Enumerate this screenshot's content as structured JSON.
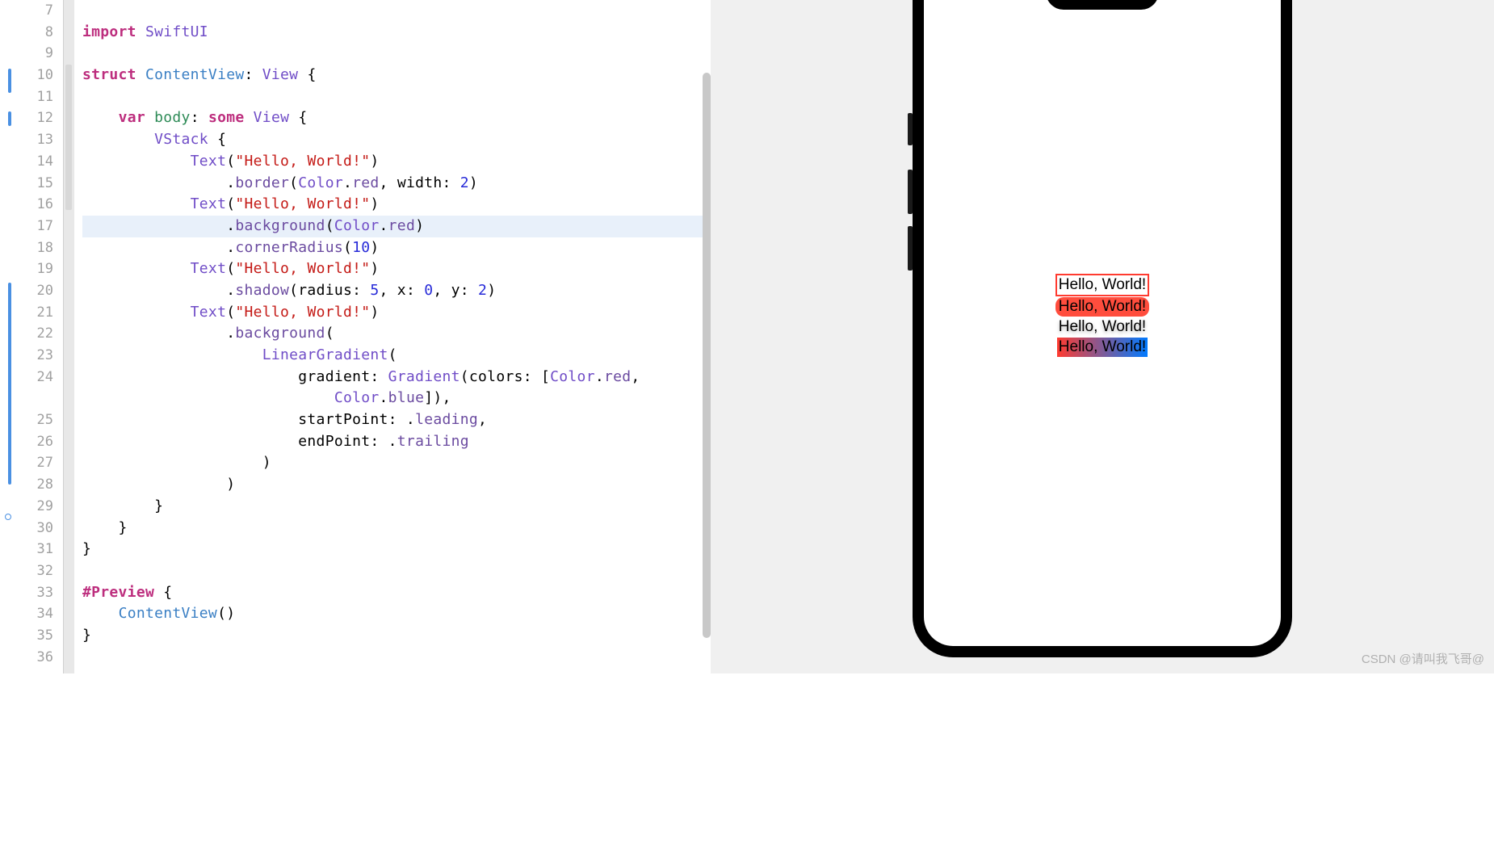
{
  "editor": {
    "lines": [
      {
        "num": 7,
        "tokens": []
      },
      {
        "num": 8,
        "tokens": [
          {
            "cls": "kw-pink",
            "t": "import"
          },
          {
            "cls": "plain",
            "t": " "
          },
          {
            "cls": "kw-builtin",
            "t": "SwiftUI"
          }
        ]
      },
      {
        "num": 9,
        "tokens": []
      },
      {
        "num": 10,
        "tokens": [
          {
            "cls": "kw-pink",
            "t": "struct"
          },
          {
            "cls": "plain",
            "t": " "
          },
          {
            "cls": "kw-type",
            "t": "ContentView"
          },
          {
            "cls": "plain",
            "t": ": "
          },
          {
            "cls": "kw-builtin",
            "t": "View"
          },
          {
            "cls": "plain",
            "t": " {"
          }
        ]
      },
      {
        "num": 11,
        "tokens": []
      },
      {
        "num": 12,
        "tokens": [
          {
            "cls": "plain",
            "t": "    "
          },
          {
            "cls": "kw-pink",
            "t": "var"
          },
          {
            "cls": "plain",
            "t": " "
          },
          {
            "cls": "kw-body",
            "t": "body"
          },
          {
            "cls": "plain",
            "t": ": "
          },
          {
            "cls": "kw-pink",
            "t": "some"
          },
          {
            "cls": "plain",
            "t": " "
          },
          {
            "cls": "kw-builtin",
            "t": "View"
          },
          {
            "cls": "plain",
            "t": " {"
          }
        ]
      },
      {
        "num": 13,
        "tokens": [
          {
            "cls": "plain",
            "t": "        "
          },
          {
            "cls": "kw-builtin",
            "t": "VStack"
          },
          {
            "cls": "plain",
            "t": " {"
          }
        ]
      },
      {
        "num": 14,
        "tokens": [
          {
            "cls": "plain",
            "t": "            "
          },
          {
            "cls": "kw-builtin",
            "t": "Text"
          },
          {
            "cls": "plain",
            "t": "("
          },
          {
            "cls": "kw-string",
            "t": "\"Hello, World!\""
          },
          {
            "cls": "plain",
            "t": ")"
          }
        ]
      },
      {
        "num": 15,
        "tokens": [
          {
            "cls": "plain",
            "t": "                ."
          },
          {
            "cls": "kw-method",
            "t": "border"
          },
          {
            "cls": "plain",
            "t": "("
          },
          {
            "cls": "kw-builtin",
            "t": "Color"
          },
          {
            "cls": "plain",
            "t": "."
          },
          {
            "cls": "kw-prop",
            "t": "red"
          },
          {
            "cls": "plain",
            "t": ", width: "
          },
          {
            "cls": "kw-num",
            "t": "2"
          },
          {
            "cls": "plain",
            "t": ")"
          }
        ]
      },
      {
        "num": 16,
        "tokens": [
          {
            "cls": "plain",
            "t": "            "
          },
          {
            "cls": "kw-builtin",
            "t": "Text"
          },
          {
            "cls": "plain",
            "t": "("
          },
          {
            "cls": "kw-string",
            "t": "\"Hello, World!\""
          },
          {
            "cls": "plain",
            "t": ")"
          }
        ]
      },
      {
        "num": 17,
        "highlighted": true,
        "tokens": [
          {
            "cls": "plain",
            "t": "                ."
          },
          {
            "cls": "kw-method",
            "t": "background"
          },
          {
            "cls": "plain",
            "t": "("
          },
          {
            "cls": "kw-builtin",
            "t": "Color"
          },
          {
            "cls": "plain",
            "t": "."
          },
          {
            "cls": "kw-prop",
            "t": "red"
          },
          {
            "cls": "plain",
            "t": ")"
          }
        ]
      },
      {
        "num": 18,
        "tokens": [
          {
            "cls": "plain",
            "t": "                ."
          },
          {
            "cls": "kw-method",
            "t": "cornerRadius"
          },
          {
            "cls": "plain",
            "t": "("
          },
          {
            "cls": "kw-num",
            "t": "10"
          },
          {
            "cls": "plain",
            "t": ")"
          }
        ]
      },
      {
        "num": 19,
        "tokens": [
          {
            "cls": "plain",
            "t": "            "
          },
          {
            "cls": "kw-builtin",
            "t": "Text"
          },
          {
            "cls": "plain",
            "t": "("
          },
          {
            "cls": "kw-string",
            "t": "\"Hello, World!\""
          },
          {
            "cls": "plain",
            "t": ")"
          }
        ]
      },
      {
        "num": 20,
        "tokens": [
          {
            "cls": "plain",
            "t": "                ."
          },
          {
            "cls": "kw-method",
            "t": "shadow"
          },
          {
            "cls": "plain",
            "t": "(radius: "
          },
          {
            "cls": "kw-num",
            "t": "5"
          },
          {
            "cls": "plain",
            "t": ", x: "
          },
          {
            "cls": "kw-num",
            "t": "0"
          },
          {
            "cls": "plain",
            "t": ", y: "
          },
          {
            "cls": "kw-num",
            "t": "2"
          },
          {
            "cls": "plain",
            "t": ")"
          }
        ]
      },
      {
        "num": 21,
        "tokens": [
          {
            "cls": "plain",
            "t": "            "
          },
          {
            "cls": "kw-builtin",
            "t": "Text"
          },
          {
            "cls": "plain",
            "t": "("
          },
          {
            "cls": "kw-string",
            "t": "\"Hello, World!\""
          },
          {
            "cls": "plain",
            "t": ")"
          }
        ]
      },
      {
        "num": 22,
        "tokens": [
          {
            "cls": "plain",
            "t": "                ."
          },
          {
            "cls": "kw-method",
            "t": "background"
          },
          {
            "cls": "plain",
            "t": "("
          }
        ]
      },
      {
        "num": 23,
        "tokens": [
          {
            "cls": "plain",
            "t": "                    "
          },
          {
            "cls": "kw-builtin",
            "t": "LinearGradient"
          },
          {
            "cls": "plain",
            "t": "("
          }
        ]
      },
      {
        "num": 24,
        "tokens": [
          {
            "cls": "plain",
            "t": "                        gradient: "
          },
          {
            "cls": "kw-builtin",
            "t": "Gradient"
          },
          {
            "cls": "plain",
            "t": "(colors: ["
          },
          {
            "cls": "kw-builtin",
            "t": "Color"
          },
          {
            "cls": "plain",
            "t": "."
          },
          {
            "cls": "kw-prop",
            "t": "red"
          },
          {
            "cls": "plain",
            "t": ","
          }
        ]
      },
      {
        "num": " ",
        "tokens": [
          {
            "cls": "plain",
            "t": "                            "
          },
          {
            "cls": "kw-builtin",
            "t": "Color"
          },
          {
            "cls": "plain",
            "t": "."
          },
          {
            "cls": "kw-prop",
            "t": "blue"
          },
          {
            "cls": "plain",
            "t": "]),"
          }
        ]
      },
      {
        "num": 25,
        "tokens": [
          {
            "cls": "plain",
            "t": "                        startPoint: ."
          },
          {
            "cls": "kw-enum",
            "t": "leading"
          },
          {
            "cls": "plain",
            "t": ","
          }
        ]
      },
      {
        "num": 26,
        "tokens": [
          {
            "cls": "plain",
            "t": "                        endPoint: ."
          },
          {
            "cls": "kw-enum",
            "t": "trailing"
          }
        ]
      },
      {
        "num": 27,
        "tokens": [
          {
            "cls": "plain",
            "t": "                    )"
          }
        ]
      },
      {
        "num": 28,
        "tokens": [
          {
            "cls": "plain",
            "t": "                )"
          }
        ]
      },
      {
        "num": 29,
        "tokens": [
          {
            "cls": "plain",
            "t": "        }"
          }
        ]
      },
      {
        "num": 30,
        "tokens": [
          {
            "cls": "plain",
            "t": "    }"
          }
        ]
      },
      {
        "num": 31,
        "tokens": [
          {
            "cls": "plain",
            "t": "}"
          }
        ]
      },
      {
        "num": 32,
        "tokens": []
      },
      {
        "num": 33,
        "tokens": [
          {
            "cls": "kw-pink",
            "t": "#Preview"
          },
          {
            "cls": "plain",
            "t": " {"
          }
        ]
      },
      {
        "num": 34,
        "tokens": [
          {
            "cls": "plain",
            "t": "    "
          },
          {
            "cls": "kw-type",
            "t": "ContentView"
          },
          {
            "cls": "plain",
            "t": "()"
          }
        ]
      },
      {
        "num": 35,
        "tokens": [
          {
            "cls": "plain",
            "t": "}"
          }
        ]
      },
      {
        "num": 36,
        "tokens": []
      }
    ]
  },
  "preview": {
    "text1": "Hello, World!",
    "text2": "Hello, World!",
    "text3": "Hello, World!",
    "text4": "Hello, World!"
  },
  "watermark": "CSDN @请叫我飞哥@"
}
